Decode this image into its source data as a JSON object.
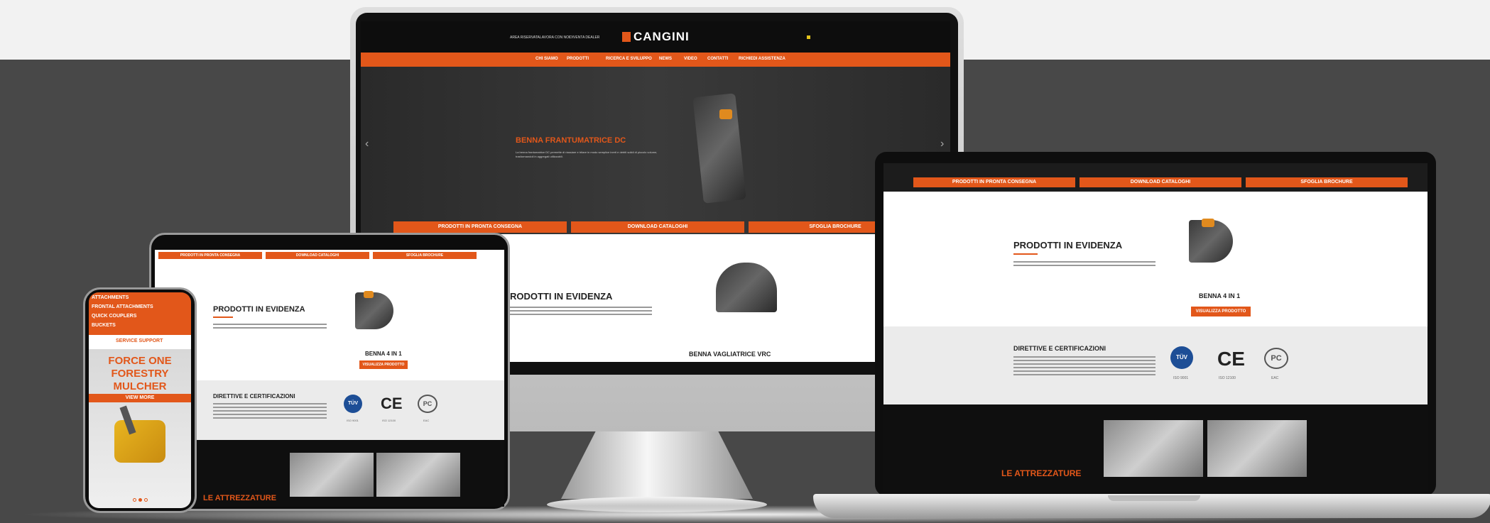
{
  "colors": {
    "brand_orange": "#e2571a",
    "dark": "#1b1b1b",
    "gray_bg": "#484848"
  },
  "monitor": {
    "top_links": [
      "AREA RISERVATA",
      "LAVORA CON NOI",
      "DIVENTA DEALER"
    ],
    "logo": "CANGINI",
    "nav": [
      "CHI SIAMO",
      "PRODOTTI",
      "RICERCA E SVILUPPO",
      "NEWS",
      "VIDEO",
      "CONTATTI",
      "RICHIEDI ASSISTENZA"
    ],
    "hero_title": "BENNA FRANTUMATRICE DC",
    "hero_text": "La benna frantumatrice DC permette di riassiare e tritare in modo semplice inerti e detriti solidi di piccolo volume, trasformandoli in aggregati utilizzabili.",
    "prev": "‹",
    "next": "›",
    "bars": [
      "PRODOTTI IN PRONTA CONSEGNA",
      "DOWNLOAD CATALOGHI",
      "SFOGLIA BROCHURE"
    ],
    "featured_title": "RODOTTI IN EVIDENZA",
    "featured_product": "BENNA VAGLIATRICE VRC"
  },
  "laptop": {
    "bars": [
      "PRODOTTI IN PRONTA CONSEGNA",
      "DOWNLOAD CATALOGHI",
      "SFOGLIA BROCHURE"
    ],
    "featured_title": "PRODOTTI IN EVIDENZA",
    "product": "BENNA 4 IN 1",
    "product_button": "VISUALIZZA PRODOTTO",
    "cert_title": "DIRETTIVE E CERTIFICAZIONI",
    "certs": [
      {
        "mark": "TÜV",
        "caption": "ISO 9001"
      },
      {
        "mark": "CE",
        "caption": "ISO 12100"
      },
      {
        "mark": "PC",
        "caption": "EAC"
      }
    ],
    "section": "LE ATTREZZATURE"
  },
  "tablet": {
    "bars": [
      "PRODOTTI IN PRONTA CONSEGNA",
      "DOWNLOAD CATALOGHI",
      "SFOGLIA BROCHURE"
    ],
    "featured_title": "PRODOTTI IN EVIDENZA",
    "product": "BENNA 4 IN 1",
    "product_button": "VISUALIZZA PRODOTTO",
    "cert_title": "DIRETTIVE E CERTIFICAZIONI",
    "certs": [
      {
        "mark": "TÜV",
        "caption": "ISO 9001"
      },
      {
        "mark": "CE",
        "caption": "ISO 12100"
      },
      {
        "mark": "PC",
        "caption": "EAC"
      }
    ],
    "section": "LE ATTREZZATURE"
  },
  "phone": {
    "menu": [
      "ATTACHMENTS",
      "FRONTAL ATTACHMENTS",
      "QUICK COUPLERS",
      "BUCKETS"
    ],
    "service": "SERVICE SUPPORT",
    "promo": [
      "FORCE ONE",
      "FORESTRY",
      "MULCHER"
    ],
    "view_more": "VIEW MORE"
  }
}
